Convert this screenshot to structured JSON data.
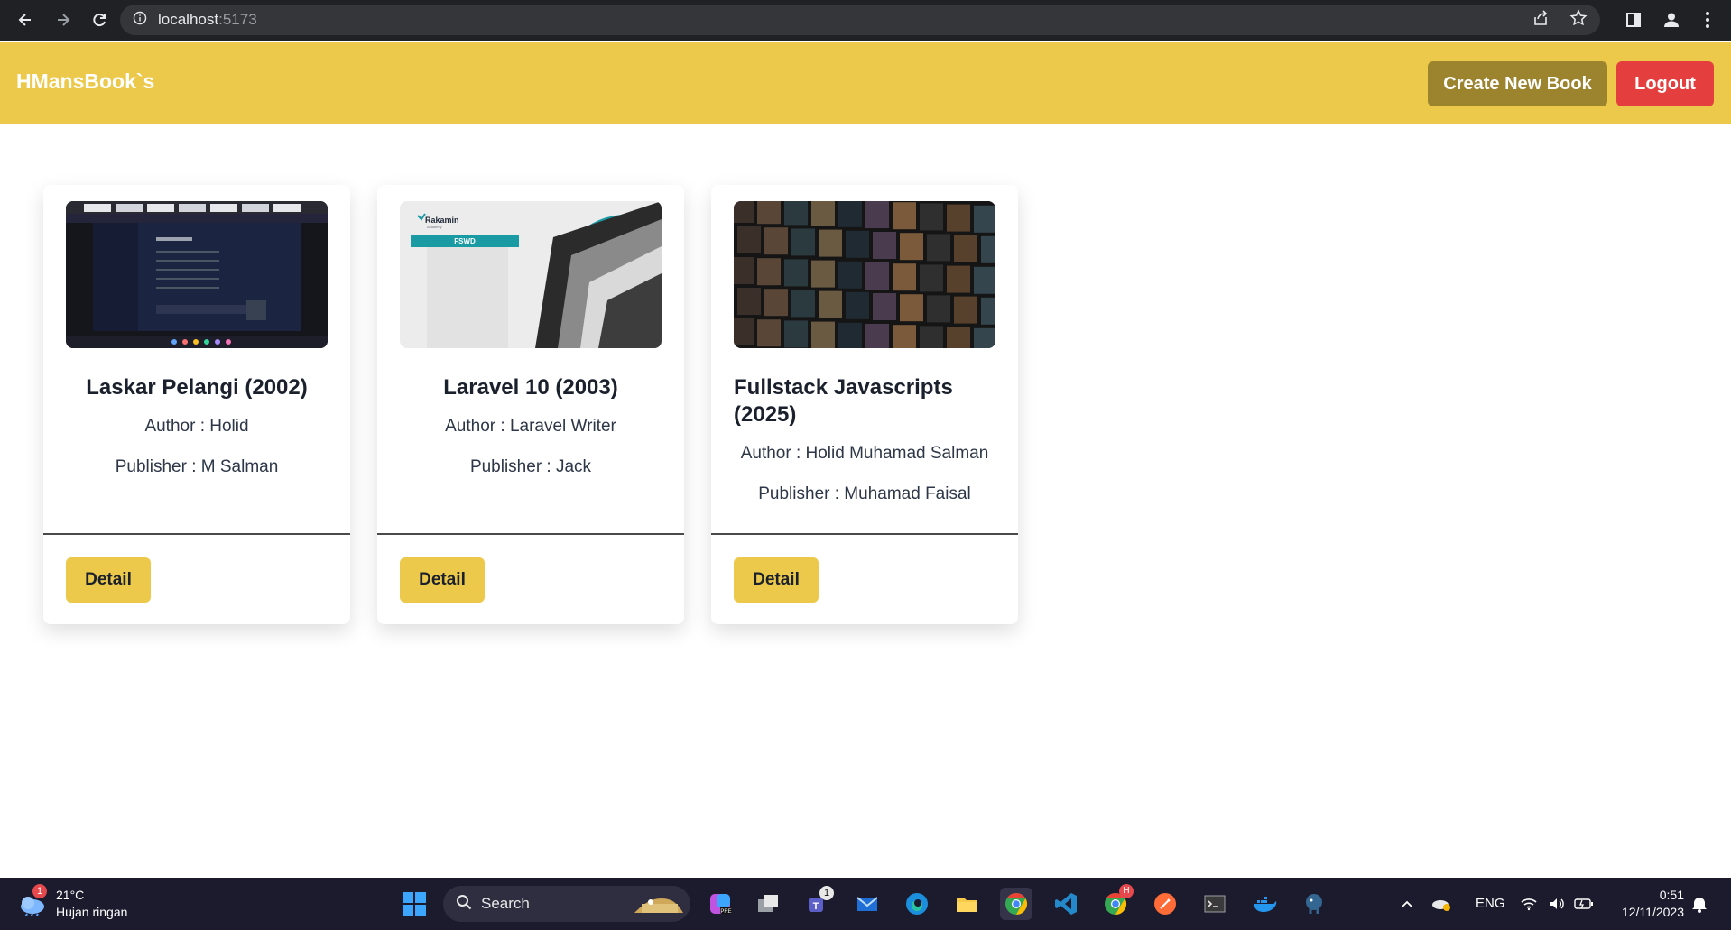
{
  "browser": {
    "url_host": "localhost",
    "url_port": ":5173"
  },
  "header": {
    "brand": "HMansBook`s",
    "create_label": "Create New Book",
    "logout_label": "Logout",
    "colors": {
      "bar": "#ecc94b",
      "create": "#9c842f",
      "logout": "#e53e3e"
    }
  },
  "books": [
    {
      "title": "Laskar Pelangi (2002)",
      "author": "Author : Holid",
      "publisher": "Publisher : M Salman",
      "detail_label": "Detail",
      "thumbnail": "screenshot-thumbnail"
    },
    {
      "title": "Laravel 10 (2003)",
      "author": "Author : Laravel Writer",
      "publisher": "Publisher : Jack",
      "detail_label": "Detail",
      "thumbnail": "rakamin-fswd-thumbnail",
      "thumb_text": {
        "brand": "Rakamin",
        "sub": "Academy",
        "badge": "FSWD"
      }
    },
    {
      "title": "Fullstack Javascripts (2025)",
      "author": "Author : Holid Muhamad Salman",
      "publisher": "Publisher : Muhamad Faisal",
      "detail_label": "Detail",
      "thumbnail": "movie-posters-thumbnail"
    }
  ],
  "taskbar": {
    "weather_temp": "21°C",
    "weather_desc": "Hujan ringan",
    "weather_badge": "1",
    "search_label": "Search",
    "language": "ENG",
    "time": "0:51",
    "date": "12/11/2023",
    "teams_badge": "1",
    "chrome_badge": "H"
  }
}
